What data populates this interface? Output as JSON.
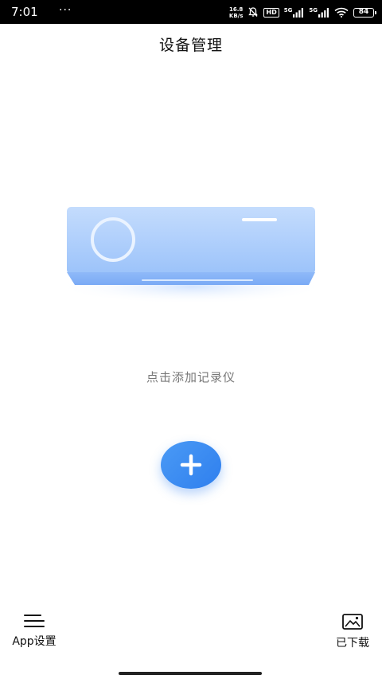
{
  "status_bar": {
    "time": "7:01",
    "dots": "···",
    "net_speed_value": "16.8",
    "net_speed_unit": "KB/s",
    "hd_label": "HD",
    "signal1_label": "5G",
    "signal2_label": "5G",
    "battery_level": "84"
  },
  "header": {
    "title": "设备管理"
  },
  "main": {
    "empty_hint": "点击添加记录仪"
  },
  "tab_bar": {
    "settings_label": "App设置",
    "downloaded_label": "已下载"
  },
  "colors": {
    "accent": "#3a8cf2",
    "illustration": "#a9cbfb",
    "hint_text": "#777777"
  },
  "icons": {
    "add": "plus-icon",
    "settings": "menu-lines-icon",
    "downloaded": "image-icon"
  }
}
